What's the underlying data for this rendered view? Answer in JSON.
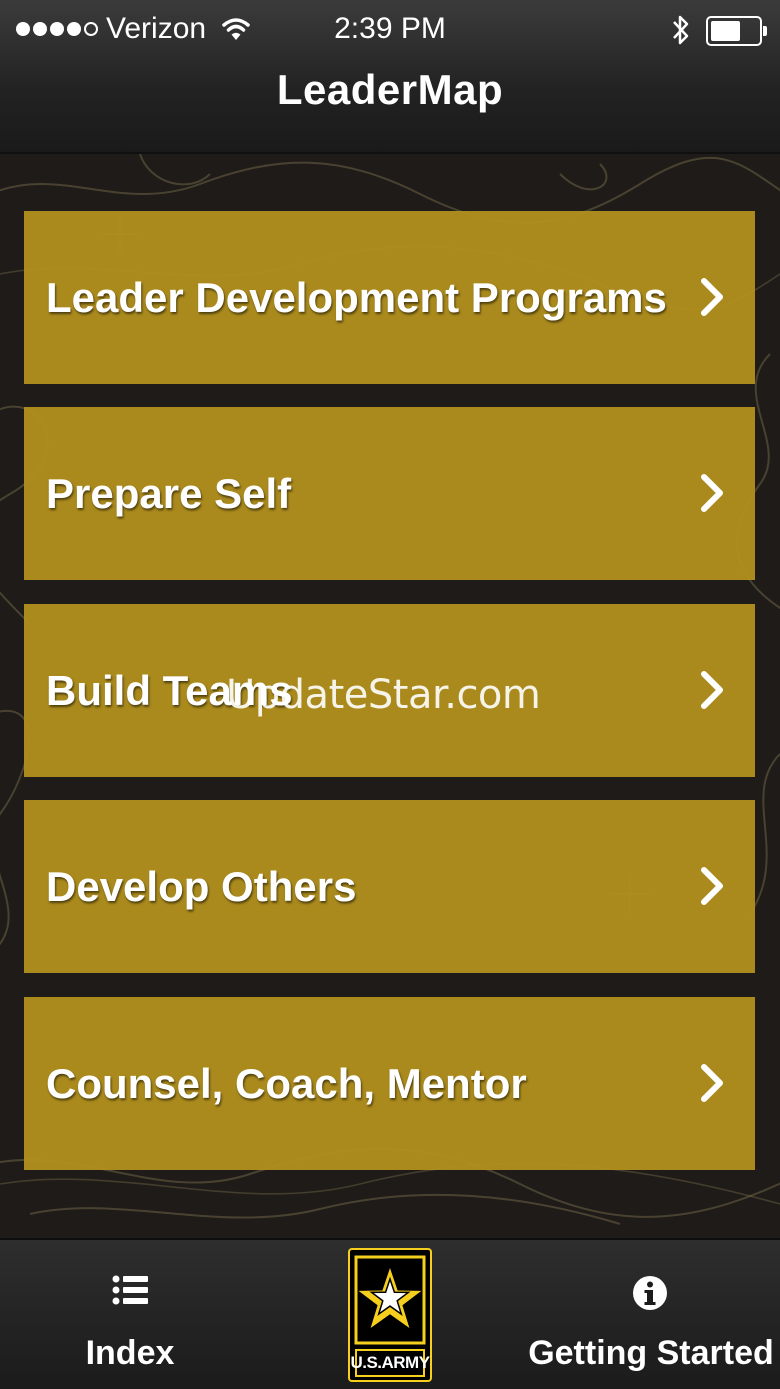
{
  "status_bar": {
    "carrier": "Verizon",
    "time": "2:39 PM",
    "signal_bars": 4,
    "battery_level": 0.6
  },
  "nav": {
    "title": "LeaderMap"
  },
  "menu": [
    {
      "label": "Leader Development Programs"
    },
    {
      "label": "Prepare Self"
    },
    {
      "label": "Build Teams"
    },
    {
      "label": "Develop Others"
    },
    {
      "label": "Counsel, Coach, Mentor"
    }
  ],
  "watermark": "UpdateStar.com",
  "tabbar": {
    "index_label": "Index",
    "logo_text": "U.S.ARMY",
    "getting_started_label": "Getting Started",
    "icons": [
      "list-icon",
      "army-star-logo",
      "info-icon"
    ]
  },
  "colors": {
    "tile": "#B5921E",
    "background": "#1C1A18",
    "logo_yellow": "#F5CE1E"
  }
}
